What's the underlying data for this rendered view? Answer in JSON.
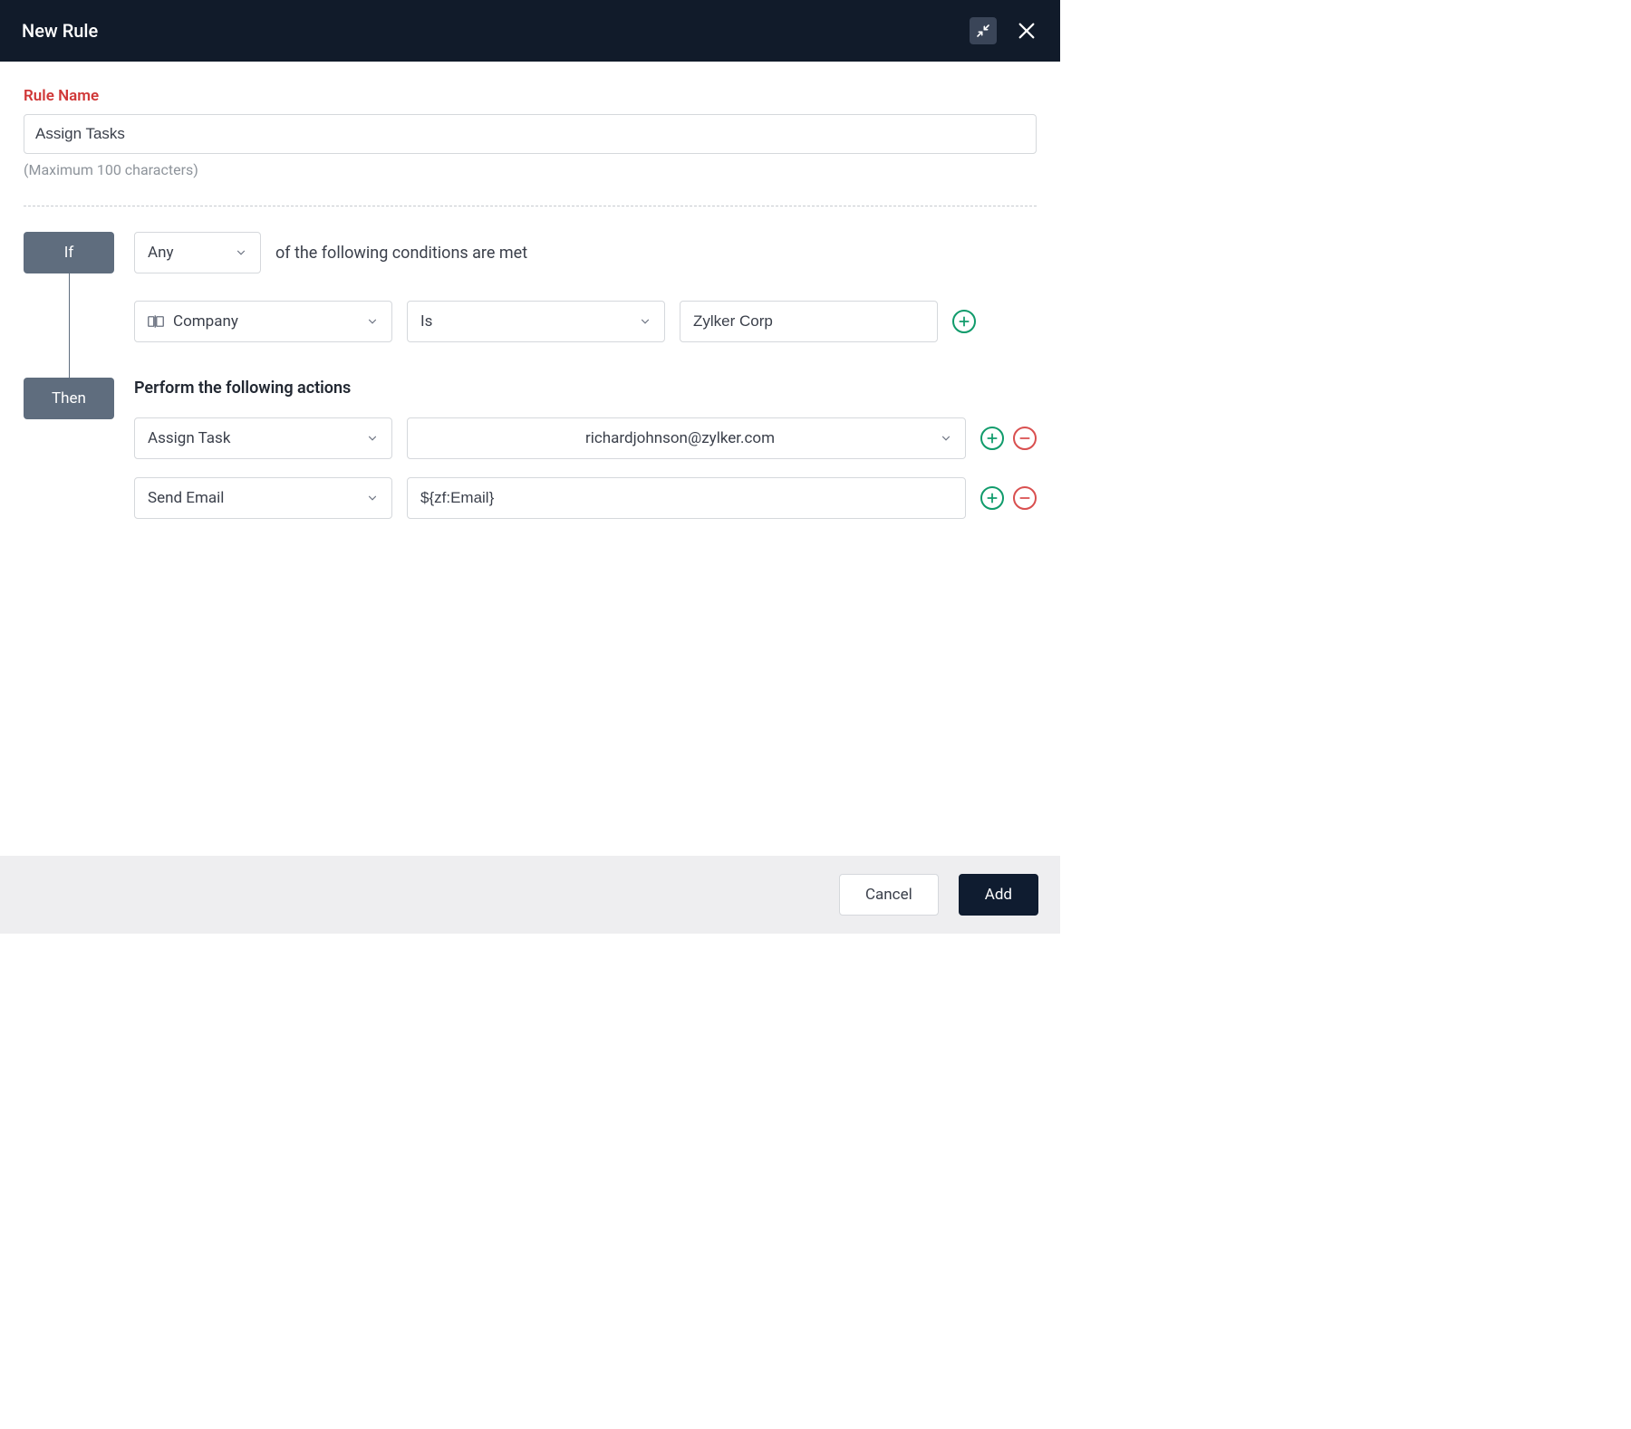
{
  "header": {
    "title": "New Rule"
  },
  "ruleName": {
    "label": "Rule Name",
    "value": "Assign Tasks",
    "hint": "(Maximum 100 characters)"
  },
  "ifTag": "If",
  "thenTag": "Then",
  "conditionMatch": {
    "value": "Any",
    "suffixText": "of the following conditions are met"
  },
  "condition": {
    "field": "Company",
    "operator": "Is",
    "value": "Zylker Corp"
  },
  "actionsTitle": "Perform the following actions",
  "actions": [
    {
      "type": "Assign Task",
      "value": "richardjohnson@zylker.com",
      "centered": true
    },
    {
      "type": "Send Email",
      "value": "${zf:Email}",
      "centered": false
    }
  ],
  "footer": {
    "cancel": "Cancel",
    "add": "Add"
  }
}
